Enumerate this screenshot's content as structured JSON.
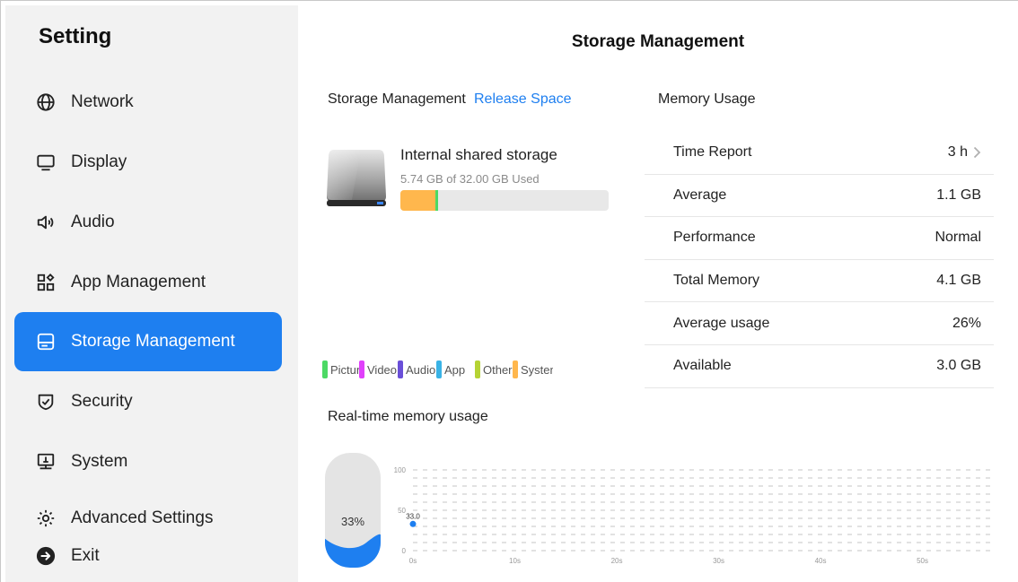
{
  "sidebar": {
    "title": "Setting",
    "items": [
      {
        "label": "Network",
        "icon": "globe-icon"
      },
      {
        "label": "Display",
        "icon": "monitor-icon"
      },
      {
        "label": "Audio",
        "icon": "speaker-icon"
      },
      {
        "label": "App Management",
        "icon": "apps-grid-icon"
      },
      {
        "label": "Storage Management",
        "icon": "storage-icon",
        "active": true
      },
      {
        "label": "Security",
        "icon": "shield-check-icon"
      },
      {
        "label": "System",
        "icon": "system-monitor-icon"
      },
      {
        "label": "Advanced Settings",
        "icon": "gear-icon"
      }
    ],
    "exit_label": "Exit",
    "accent": "#1e7ff0"
  },
  "main": {
    "title": "Storage Management",
    "storage": {
      "heading": "Storage Management",
      "release_link": "Release Space",
      "device_name": "Internal shared storage",
      "usage_text": "5.74 GB of 32.00 GB Used",
      "used_fraction": 0.179,
      "legend": [
        {
          "label": "Pictures",
          "color": "#4cd964"
        },
        {
          "label": "Video",
          "color": "#e040fb"
        },
        {
          "label": "Audio",
          "color": "#6a4fd8"
        },
        {
          "label": "App",
          "color": "#3ab3e6"
        },
        {
          "label": "Other",
          "color": "#b5d334"
        },
        {
          "label": "System",
          "color": "#ffb74d"
        }
      ]
    },
    "memory": {
      "heading": "Memory Usage",
      "rows": [
        {
          "label": "Time Report",
          "value": "3 h",
          "chevron": true
        },
        {
          "label": "Average",
          "value": "1.1 GB"
        },
        {
          "label": "Performance",
          "value": "Normal"
        },
        {
          "label": "Total Memory",
          "value": "4.1 GB"
        },
        {
          "label": "Average usage",
          "value": "26%"
        },
        {
          "label": "Available",
          "value": "3.0 GB"
        }
      ]
    },
    "realtime": {
      "heading": "Real-time memory usage",
      "gauge_label": "33%",
      "gauge_fraction": 0.33
    }
  },
  "chart_data": {
    "type": "scatter",
    "x": [
      0
    ],
    "y": [
      33.0
    ],
    "data_labels": [
      "33.0"
    ],
    "xticks": [
      "0s",
      "10s",
      "20s",
      "30s",
      "40s",
      "50s"
    ],
    "yticks": [
      "0",
      "50",
      "100"
    ],
    "xlim": [
      0,
      57
    ],
    "ylim": [
      0,
      100
    ],
    "grid": true,
    "point_color": "#1e7ff0"
  }
}
